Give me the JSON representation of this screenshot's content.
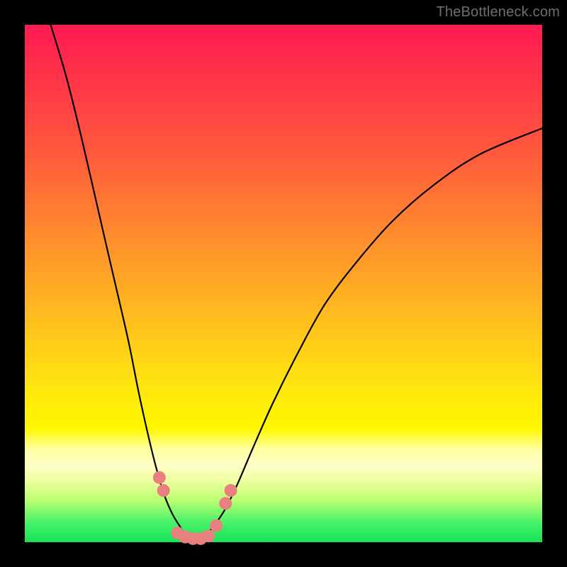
{
  "watermark": "TheBottleneck.com",
  "chart_data": {
    "type": "line",
    "title": "",
    "xlabel": "",
    "ylabel": "",
    "xlim": [
      0,
      100
    ],
    "ylim": [
      0,
      100
    ],
    "grid": false,
    "legend": null,
    "background_gradient_stops": [
      {
        "pos": 0,
        "color": "#ff1a52"
      },
      {
        "pos": 10,
        "color": "#ff3348"
      },
      {
        "pos": 25,
        "color": "#ff5a3c"
      },
      {
        "pos": 40,
        "color": "#ff8a2e"
      },
      {
        "pos": 55,
        "color": "#ffb820"
      },
      {
        "pos": 70,
        "color": "#ffe610"
      },
      {
        "pos": 78,
        "color": "#fff700"
      },
      {
        "pos": 82,
        "color": "#ffffa0"
      },
      {
        "pos": 85,
        "color": "#ffffc8"
      },
      {
        "pos": 88,
        "color": "#f0ffa0"
      },
      {
        "pos": 92,
        "color": "#b8ff70"
      },
      {
        "pos": 96,
        "color": "#4cf26a"
      },
      {
        "pos": 100,
        "color": "#14e35a"
      }
    ],
    "series": [
      {
        "name": "left-curve",
        "x": [
          5,
          8,
          11,
          14,
          17,
          20,
          22,
          24,
          25.5,
          27,
          28.5,
          30,
          31,
          32
        ],
        "y": [
          100,
          90,
          78,
          65,
          52,
          39,
          29,
          20,
          14,
          9,
          5.5,
          3,
          1.5,
          0.5
        ]
      },
      {
        "name": "right-curve",
        "x": [
          34,
          36,
          38.5,
          41,
          44,
          48,
          53,
          58,
          64,
          71,
          79,
          88,
          100
        ],
        "y": [
          0.5,
          2.5,
          6,
          11,
          18,
          27,
          37,
          46,
          54,
          62,
          69,
          75,
          80
        ]
      },
      {
        "name": "markers",
        "type": "scatter",
        "marker_color": "#e88080",
        "marker_radius": 9,
        "points": [
          {
            "x": 26.0,
            "y": 12.5
          },
          {
            "x": 26.8,
            "y": 10.0
          },
          {
            "x": 29.5,
            "y": 1.8
          },
          {
            "x": 31.0,
            "y": 1.0
          },
          {
            "x": 32.5,
            "y": 0.7
          },
          {
            "x": 34.0,
            "y": 0.7
          },
          {
            "x": 35.5,
            "y": 1.2
          },
          {
            "x": 37.0,
            "y": 3.2
          },
          {
            "x": 38.8,
            "y": 7.5
          },
          {
            "x": 39.8,
            "y": 10.0
          }
        ]
      }
    ]
  }
}
